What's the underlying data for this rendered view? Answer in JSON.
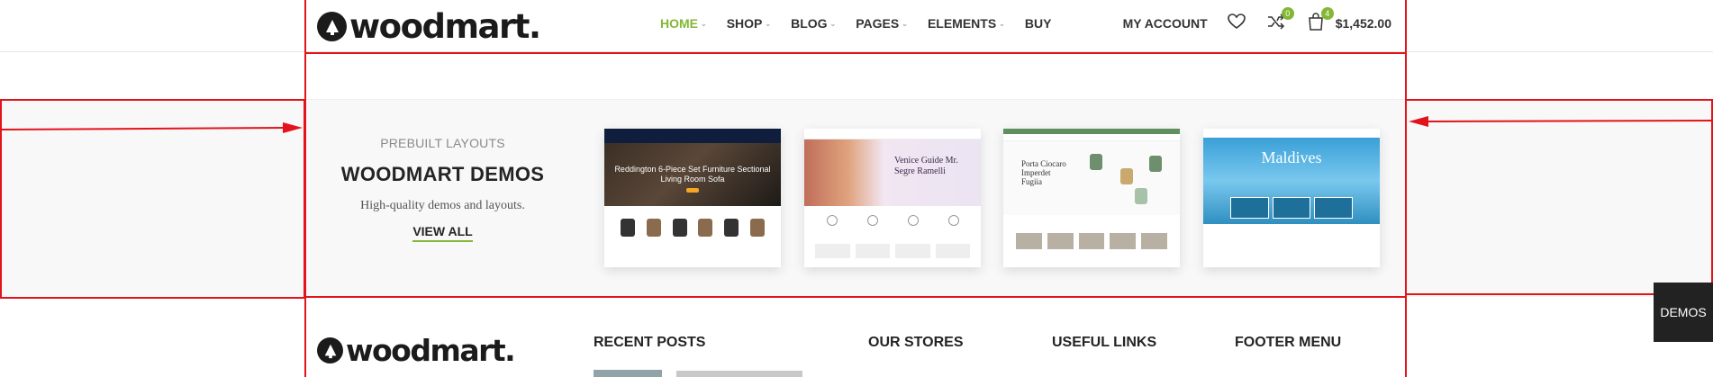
{
  "header": {
    "logo_text": "woodmart.",
    "nav": [
      {
        "label": "HOME",
        "active": true,
        "has_dropdown": true
      },
      {
        "label": "SHOP",
        "has_dropdown": true
      },
      {
        "label": "BLOG",
        "has_dropdown": true
      },
      {
        "label": "PAGES",
        "has_dropdown": true
      },
      {
        "label": "ELEMENTS",
        "has_dropdown": true
      },
      {
        "label": "BUY",
        "has_dropdown": false
      }
    ],
    "account": "MY ACCOUNT",
    "compare_count": "0",
    "cart_count": "4",
    "cart_total": "$1,452.00"
  },
  "demos": {
    "subtitle": "PREBUILT LAYOUTS",
    "title": "WOODMART DEMOS",
    "description": "High-quality demos and layouts.",
    "view_all": "VIEW ALL",
    "thumbs": [
      {
        "hero_text": "Reddington 6-Piece Set Furniture Sectional Living Room Sofa"
      },
      {
        "hero_text": "Venice Guide Mr. Segre Ramelli"
      },
      {
        "hero_text": "Porta Ciocaro Imperdet Fugiia"
      },
      {
        "hero_text": "Maldives"
      }
    ]
  },
  "footer": {
    "logo_text": "woodmart.",
    "columns": [
      "RECENT POSTS",
      "OUR STORES",
      "USEFUL LINKS",
      "FOOTER MENU"
    ]
  },
  "demos_tab": "DEMOS",
  "colors": {
    "accent": "#83b735",
    "annotation": "#e3131b"
  }
}
